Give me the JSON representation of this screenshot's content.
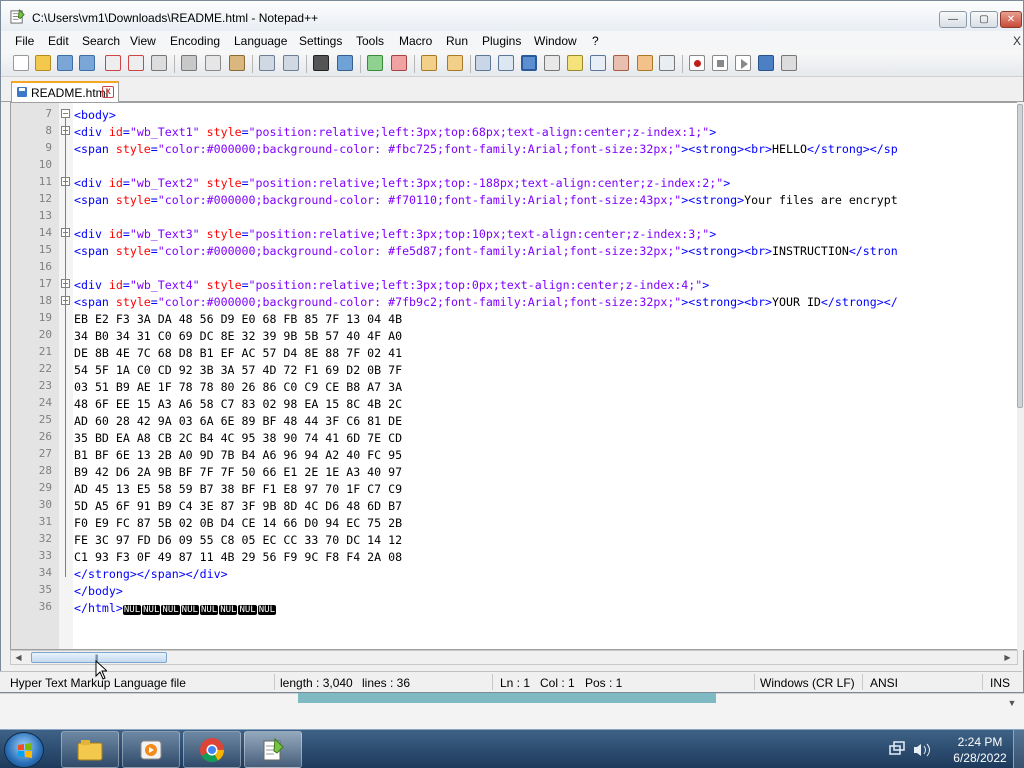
{
  "window": {
    "title": "C:\\Users\\vm1\\Downloads\\README.html - Notepad++",
    "min_label": "—",
    "max_label": "▢",
    "close_label": "✕"
  },
  "menu": {
    "items": [
      "File",
      "Edit",
      "Search",
      "View",
      "Encoding",
      "Language",
      "Settings",
      "Tools",
      "Macro",
      "Run",
      "Plugins",
      "Window",
      "?"
    ],
    "close_label": "X"
  },
  "tab": {
    "label": "README.html",
    "close_label": "x",
    "accent_color": "#f5a623"
  },
  "editor": {
    "colors": {
      "tag": "#0000ff",
      "attribute": "#ff0000",
      "value": "#8000ff",
      "text": "#000000"
    },
    "lines": [
      {
        "n": "7",
        "fold": true,
        "tokens": [
          [
            "tag",
            "<body>"
          ]
        ]
      },
      {
        "n": "8",
        "fold": true,
        "tokens": [
          [
            "tag",
            "<div "
          ],
          [
            "attr",
            "id"
          ],
          [
            "tag",
            "="
          ],
          [
            "val",
            "\"wb_Text1\""
          ],
          [
            "tag",
            " "
          ],
          [
            "attr",
            "style"
          ],
          [
            "tag",
            "="
          ],
          [
            "val",
            "\"position:relative;left:3px;top:68px;text-align:center;z-index:1;\""
          ],
          [
            "tag",
            ">"
          ]
        ]
      },
      {
        "n": "9",
        "fold": false,
        "tokens": [
          [
            "tag",
            "<span "
          ],
          [
            "attr",
            "style"
          ],
          [
            "tag",
            "="
          ],
          [
            "val",
            "\"color:#000000;background-color: #fbc725;font-family:Arial;font-size:32px;\""
          ],
          [
            "tag",
            "><strong><br>"
          ],
          [
            "txt",
            "HELLO"
          ],
          [
            "tag",
            "</strong></sp"
          ]
        ]
      },
      {
        "n": "10",
        "fold": false,
        "tokens": []
      },
      {
        "n": "11",
        "fold": true,
        "tokens": [
          [
            "tag",
            "<div "
          ],
          [
            "attr",
            "id"
          ],
          [
            "tag",
            "="
          ],
          [
            "val",
            "\"wb_Text2\""
          ],
          [
            "tag",
            " "
          ],
          [
            "attr",
            "style"
          ],
          [
            "tag",
            "="
          ],
          [
            "val",
            "\"position:relative;left:3px;top:-188px;text-align:center;z-index:2;\""
          ],
          [
            "tag",
            ">"
          ]
        ]
      },
      {
        "n": "12",
        "fold": false,
        "tokens": [
          [
            "tag",
            "<span "
          ],
          [
            "attr",
            "style"
          ],
          [
            "tag",
            "="
          ],
          [
            "val",
            "\"color:#000000;background-color: #f70110;font-family:Arial;font-size:43px;\""
          ],
          [
            "tag",
            "><strong>"
          ],
          [
            "txt",
            "Your files are encrypt"
          ]
        ]
      },
      {
        "n": "13",
        "fold": false,
        "tokens": []
      },
      {
        "n": "14",
        "fold": true,
        "tokens": [
          [
            "tag",
            "<div "
          ],
          [
            "attr",
            "id"
          ],
          [
            "tag",
            "="
          ],
          [
            "val",
            "\"wb_Text3\""
          ],
          [
            "tag",
            " "
          ],
          [
            "attr",
            "style"
          ],
          [
            "tag",
            "="
          ],
          [
            "val",
            "\"position:relative;left:3px;top:10px;text-align:center;z-index:3;\""
          ],
          [
            "tag",
            ">"
          ]
        ]
      },
      {
        "n": "15",
        "fold": false,
        "tokens": [
          [
            "tag",
            "<span "
          ],
          [
            "attr",
            "style"
          ],
          [
            "tag",
            "="
          ],
          [
            "val",
            "\"color:#000000;background-color: #fe5d87;font-family:Arial;font-size:32px;\""
          ],
          [
            "tag",
            "><strong><br>"
          ],
          [
            "txt",
            "INSTRUCTION"
          ],
          [
            "tag",
            "</stron"
          ]
        ]
      },
      {
        "n": "16",
        "fold": false,
        "tokens": []
      },
      {
        "n": "17",
        "fold": true,
        "tokens": [
          [
            "tag",
            "<div "
          ],
          [
            "attr",
            "id"
          ],
          [
            "tag",
            "="
          ],
          [
            "val",
            "\"wb_Text4\""
          ],
          [
            "tag",
            " "
          ],
          [
            "attr",
            "style"
          ],
          [
            "tag",
            "="
          ],
          [
            "val",
            "\"position:relative;left:3px;top:0px;text-align:center;z-index:4;\""
          ],
          [
            "tag",
            ">"
          ]
        ]
      },
      {
        "n": "18",
        "fold": true,
        "tokens": [
          [
            "tag",
            "<span "
          ],
          [
            "attr",
            "style"
          ],
          [
            "tag",
            "="
          ],
          [
            "val",
            "\"color:#000000;background-color: #7fb9c2;font-family:Arial;font-size:32px;\""
          ],
          [
            "tag",
            "><strong><br>"
          ],
          [
            "txt",
            "YOUR ID"
          ],
          [
            "tag",
            "</strong></"
          ]
        ]
      },
      {
        "n": "19",
        "fold": false,
        "tokens": [
          [
            "txt",
            "EB E2 F3 3A DA 48 56 D9 E0 68 FB 85 7F 13 04 4B"
          ]
        ]
      },
      {
        "n": "20",
        "fold": false,
        "tokens": [
          [
            "txt",
            "34 B0 34 31 C0 69 DC 8E 32 39 9B 5B 57 40 4F A0"
          ]
        ]
      },
      {
        "n": "21",
        "fold": false,
        "tokens": [
          [
            "txt",
            "DE 8B 4E 7C 68 D8 B1 EF AC 57 D4 8E 88 7F 02 41"
          ]
        ]
      },
      {
        "n": "22",
        "fold": false,
        "tokens": [
          [
            "txt",
            "54 5F 1A C0 CD 92 3B 3A 57 4D 72 F1 69 D2 0B 7F"
          ]
        ]
      },
      {
        "n": "23",
        "fold": false,
        "tokens": [
          [
            "txt",
            "03 51 B9 AE 1F 78 78 80 26 86 C0 C9 CE B8 A7 3A"
          ]
        ]
      },
      {
        "n": "24",
        "fold": false,
        "tokens": [
          [
            "txt",
            "48 6F EE 15 A3 A6 58 C7 83 02 98 EA 15 8C 4B 2C"
          ]
        ]
      },
      {
        "n": "25",
        "fold": false,
        "tokens": [
          [
            "txt",
            "AD 60 28 42 9A 03 6A 6E 89 BF 48 44 3F C6 81 DE"
          ]
        ]
      },
      {
        "n": "26",
        "fold": false,
        "tokens": [
          [
            "txt",
            "35 BD EA A8 CB 2C B4 4C 95 38 90 74 41 6D 7E CD"
          ]
        ]
      },
      {
        "n": "27",
        "fold": false,
        "tokens": [
          [
            "txt",
            "B1 BF 6E 13 2B A0 9D 7B B4 A6 96 94 A2 40 FC 95"
          ]
        ]
      },
      {
        "n": "28",
        "fold": false,
        "tokens": [
          [
            "txt",
            "B9 42 D6 2A 9B BF 7F 7F 50 66 E1 2E 1E A3 40 97"
          ]
        ]
      },
      {
        "n": "29",
        "fold": false,
        "tokens": [
          [
            "txt",
            "AD 45 13 E5 58 59 B7 38 BF F1 E8 97 70 1F C7 C9"
          ]
        ]
      },
      {
        "n": "30",
        "fold": false,
        "tokens": [
          [
            "txt",
            "5D A5 6F 91 B9 C4 3E 87 3F 9B 8D 4C D6 48 6D B7"
          ]
        ]
      },
      {
        "n": "31",
        "fold": false,
        "tokens": [
          [
            "txt",
            "F0 E9 FC 87 5B 02 0B D4 CE 14 66 D0 94 EC 75 2B"
          ]
        ]
      },
      {
        "n": "32",
        "fold": false,
        "tokens": [
          [
            "txt",
            "FE 3C 97 FD D6 09 55 C8 05 EC CC 33 70 DC 14 12"
          ]
        ]
      },
      {
        "n": "33",
        "fold": false,
        "tokens": [
          [
            "txt",
            "C1 93 F3 0F 49 87 11 4B 29 56 F9 9C F8 F4 2A 08"
          ]
        ]
      },
      {
        "n": "34",
        "fold": false,
        "tokens": [
          [
            "tag",
            "</strong></span></div>"
          ]
        ]
      },
      {
        "n": "35",
        "fold": false,
        "tokens": [
          [
            "tag",
            "</body>"
          ]
        ]
      },
      {
        "n": "36",
        "fold": false,
        "tokens": [
          [
            "tag",
            "</html>"
          ],
          [
            "nul",
            "NUL"
          ],
          [
            "nul",
            "NUL"
          ],
          [
            "nul",
            "NUL"
          ],
          [
            "nul",
            "NUL"
          ],
          [
            "nul",
            "NUL"
          ],
          [
            "nul",
            "NUL"
          ],
          [
            "nul",
            "NUL"
          ],
          [
            "nul",
            "NUL"
          ]
        ]
      }
    ]
  },
  "statusbar": {
    "filetype": "Hyper Text Markup Language file",
    "length": "length : 3,040",
    "lines": "lines : 36",
    "ln": "Ln : 1",
    "col": "Col : 1",
    "pos": "Pos : 1",
    "eol": "Windows (CR LF)",
    "encoding": "ANSI",
    "mode": "INS"
  },
  "taskbar": {
    "time": "2:24 PM",
    "date": "6/28/2022",
    "apps": [
      "file-explorer-icon",
      "media-player-icon",
      "chrome-icon",
      "notepadpp-icon"
    ]
  }
}
